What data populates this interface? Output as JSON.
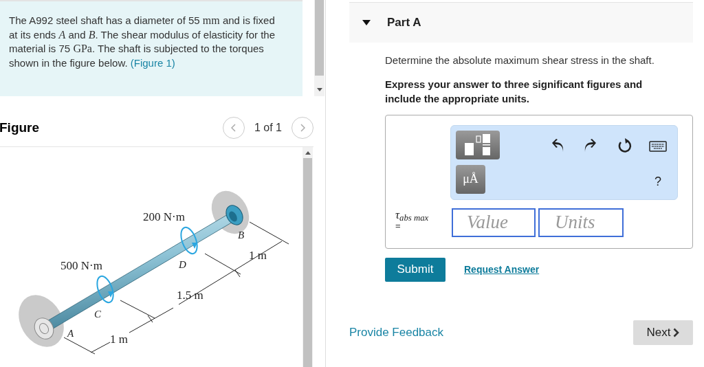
{
  "problem": {
    "segments": [
      {
        "kind": "text",
        "text": "The A992 steel shaft has a diameter of 55 "
      },
      {
        "kind": "math",
        "text": "mm"
      },
      {
        "kind": "text",
        "text": " and is fixed at its ends "
      },
      {
        "kind": "math_italic",
        "text": "A"
      },
      {
        "kind": "text",
        "text": " and "
      },
      {
        "kind": "math_italic",
        "text": "B"
      },
      {
        "kind": "text",
        "text": ". The shear modulus of elasticity for the material is 75 "
      },
      {
        "kind": "math",
        "text": "GPa"
      },
      {
        "kind": "text",
        "text": ". The shaft is subjected to the torques shown in the figure below. "
      },
      {
        "kind": "link",
        "text": "(Figure 1)"
      }
    ]
  },
  "figure": {
    "title": "Figure",
    "pager": "1 of 1",
    "labels": [
      "200 N·m",
      "500 N·m",
      "B",
      "D",
      "1 m",
      "1.5 m",
      "C",
      "A",
      "1 m"
    ]
  },
  "part": {
    "title": "Part A",
    "expanded": true,
    "prompt": "Determine the absolute maximum shear stress in the shaft.",
    "instruction": "Express your answer to three significant figures and include the appropriate units.",
    "units_symbol": "μÅ",
    "help": "?",
    "answer": {
      "symbol": "τ$_{abs max}$",
      "equals": "=",
      "value_placeholder": "Value",
      "units_placeholder": "Units"
    },
    "submit": "Submit",
    "request": "Request Answer"
  },
  "feedback": "Provide Feedback",
  "next": "Next"
}
